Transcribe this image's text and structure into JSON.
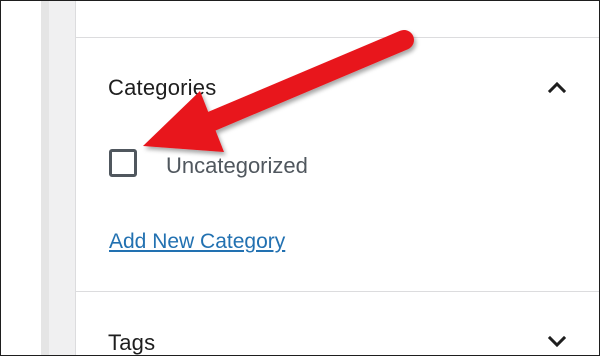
{
  "sidebar": {
    "categories": {
      "title": "Categories",
      "toggle_icon": "chevron-up-icon",
      "items": [
        {
          "label": "Uncategorized",
          "checked": false
        }
      ],
      "add_link": "Add New Category"
    },
    "tags": {
      "title": "Tags",
      "toggle_icon": "chevron-down-icon"
    }
  },
  "annotation": {
    "arrow_color": "#e8141b"
  },
  "colors": {
    "link": "#2271b1",
    "text": "#1e1e1e",
    "muted": "#50575e",
    "divider": "#dcdcde"
  }
}
